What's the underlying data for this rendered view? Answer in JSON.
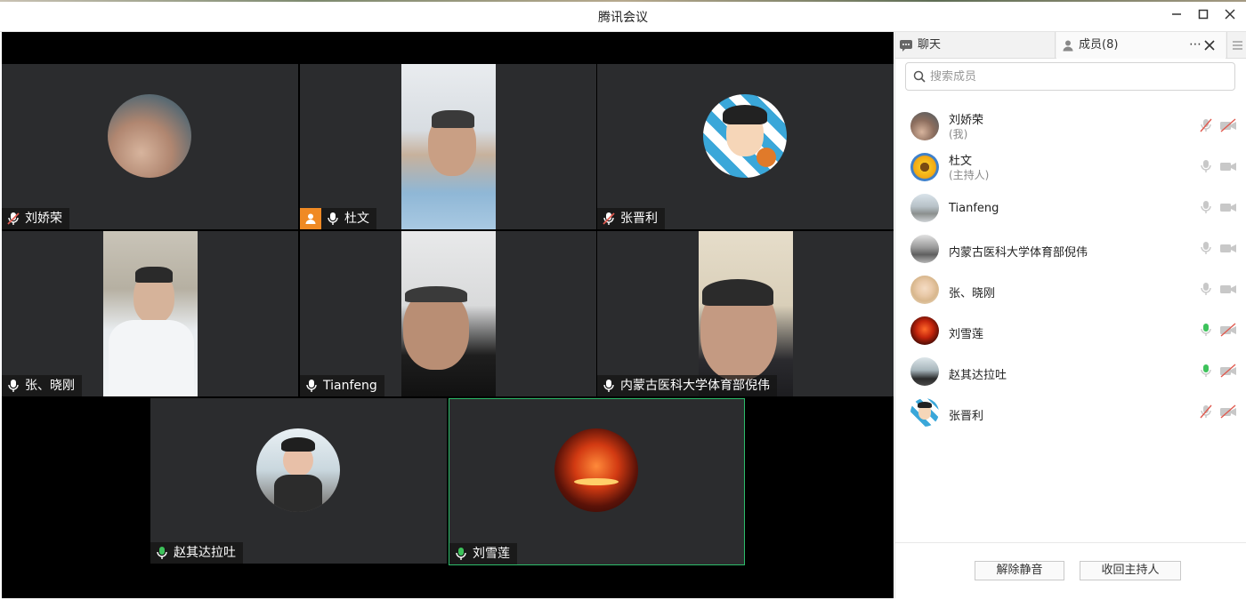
{
  "window": {
    "title": "腾讯会议"
  },
  "video": {
    "participants": [
      {
        "name": "刘娇荣",
        "mic": "muted"
      },
      {
        "name": "杜文",
        "mic": "on",
        "host": true
      },
      {
        "name": "张晋利",
        "mic": "muted"
      },
      {
        "name": "张、晓刚",
        "mic": "on"
      },
      {
        "name": "Tianfeng",
        "mic": "on"
      },
      {
        "name": "内蒙古医科大学体育部倪伟",
        "mic": "on"
      },
      {
        "name": "赵其达拉吐",
        "mic": "speaking"
      },
      {
        "name": "刘雪莲",
        "mic": "speaking",
        "active_speaker": true
      }
    ]
  },
  "panel": {
    "tabs": [
      {
        "label": "聊天"
      },
      {
        "label": "成员(8)"
      }
    ],
    "search": {
      "placeholder": "搜索成员"
    },
    "members": [
      {
        "name": "刘娇荣",
        "role": "(我)",
        "mic": "muted",
        "camera": "off"
      },
      {
        "name": "杜文",
        "role": "(主持人)",
        "mic": "idle",
        "camera": "idle"
      },
      {
        "name": "Tianfeng",
        "role": "",
        "mic": "idle",
        "camera": "idle"
      },
      {
        "name": "内蒙古医科大学体育部倪伟",
        "role": "",
        "mic": "idle",
        "camera": "idle"
      },
      {
        "name": "张、晓刚",
        "role": "",
        "mic": "idle",
        "camera": "idle"
      },
      {
        "name": "刘雪莲",
        "role": "",
        "mic": "speaking",
        "camera": "off"
      },
      {
        "name": "赵其达拉吐",
        "role": "",
        "mic": "speaking",
        "camera": "off"
      },
      {
        "name": "张晋利",
        "role": "",
        "mic": "muted",
        "camera": "off"
      }
    ],
    "buttons": {
      "unmute_all": "解除静音",
      "reclaim_host": "收回主持人"
    }
  },
  "colors": {
    "speaking_green": "#3dc25b",
    "muted_red": "#e05a4f",
    "host_orange": "#f08a24",
    "tile_bg": "#2b2c2e"
  }
}
